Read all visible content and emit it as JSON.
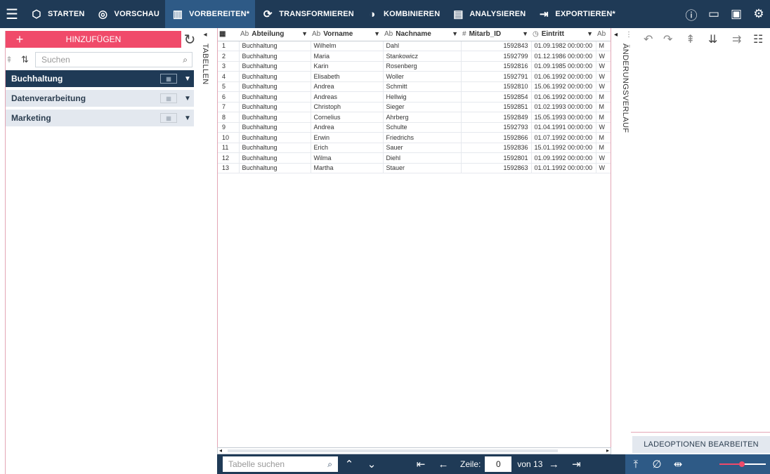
{
  "toolbar": {
    "menu_icon": "hamburger-icon",
    "items": [
      {
        "label": "STARTEN",
        "icon": "cube-icon",
        "glyph": "⬡"
      },
      {
        "label": "VORSCHAU",
        "icon": "eye-icon",
        "glyph": "◎"
      },
      {
        "label": "VORBEREITEN*",
        "icon": "columns-icon",
        "glyph": "▥"
      },
      {
        "label": "TRANSFORMIEREN",
        "icon": "transform-icon",
        "glyph": "⟳"
      },
      {
        "label": "KOMBINIEREN",
        "icon": "combine-icon",
        "glyph": "◑"
      },
      {
        "label": "ANALYSIEREN",
        "icon": "clipboard-icon",
        "glyph": "▤"
      },
      {
        "label": "EXPORTIEREN*",
        "icon": "export-icon",
        "glyph": "⇥"
      }
    ],
    "right_icons": [
      "info-icon",
      "window-icon",
      "book-icon",
      "settings-icon"
    ]
  },
  "left_panel": {
    "add_label": "HINZUFÜGEN",
    "vertical_label": "TABELLEN",
    "search_placeholder": "Suchen",
    "groups": [
      "Buchhaltung",
      "Datenverarbeitung",
      "Marketing"
    ]
  },
  "grid": {
    "columns": [
      {
        "type": "Ab",
        "name": "Abteilung"
      },
      {
        "type": "Ab",
        "name": "Vorname"
      },
      {
        "type": "Ab",
        "name": "Nachname"
      },
      {
        "type": "#",
        "name": "Mitarb_ID"
      },
      {
        "type": "◷",
        "name": "Eintritt"
      },
      {
        "type": "Ab",
        "name": ""
      }
    ],
    "rows": [
      [
        "1",
        "Buchhaltung",
        "Wilhelm",
        "Dahl",
        "1592843",
        "01.09.1982 00:00:00",
        "M"
      ],
      [
        "2",
        "Buchhaltung",
        "Maria",
        "Stankowicz",
        "1592799",
        "01.12.1986 00:00:00",
        "W"
      ],
      [
        "3",
        "Buchhaltung",
        "Karin",
        "Rosenberg",
        "1592816",
        "01.09.1985 00:00:00",
        "W"
      ],
      [
        "4",
        "Buchhaltung",
        "Elisabeth",
        "Woller",
        "1592791",
        "01.06.1992 00:00:00",
        "W"
      ],
      [
        "5",
        "Buchhaltung",
        "Andrea",
        "Schmitt",
        "1592810",
        "15.06.1992 00:00:00",
        "W"
      ],
      [
        "6",
        "Buchhaltung",
        "Andreas",
        "Hellwig",
        "1592854",
        "01.06.1992 00:00:00",
        "M"
      ],
      [
        "7",
        "Buchhaltung",
        "Christoph",
        "Sieger",
        "1592851",
        "01.02.1993 00:00:00",
        "M"
      ],
      [
        "8",
        "Buchhaltung",
        "Cornelius",
        "Ahrberg",
        "1592849",
        "15.05.1993 00:00:00",
        "M"
      ],
      [
        "9",
        "Buchhaltung",
        "Andrea",
        "Schulte",
        "1592793",
        "01.04.1991 00:00:00",
        "W"
      ],
      [
        "10",
        "Buchhaltung",
        "Erwin",
        "Friedrichs",
        "1592866",
        "01.07.1992 00:00:00",
        "M"
      ],
      [
        "11",
        "Buchhaltung",
        "Erich",
        "Sauer",
        "1592836",
        "15.01.1992 00:00:00",
        "M"
      ],
      [
        "12",
        "Buchhaltung",
        "Wilma",
        "Diehl",
        "1592801",
        "01.09.1992 00:00:00",
        "W"
      ],
      [
        "13",
        "Buchhaltung",
        "Martha",
        "Stauer",
        "1592863",
        "01.01.1992 00:00:00",
        "W"
      ]
    ]
  },
  "right_panel": {
    "vertical_label": "ÄNDERUNGSVERLAUF",
    "load_button": "LADEOPTIONEN BEARBEITEN"
  },
  "bottom": {
    "search_placeholder": "Tabelle suchen",
    "row_label": "Zeile:",
    "row_value": "0",
    "of_label": "von 13"
  },
  "colors": {
    "navy": "#1f3a56",
    "active": "#2e5a86",
    "accent": "#f04a6a"
  }
}
